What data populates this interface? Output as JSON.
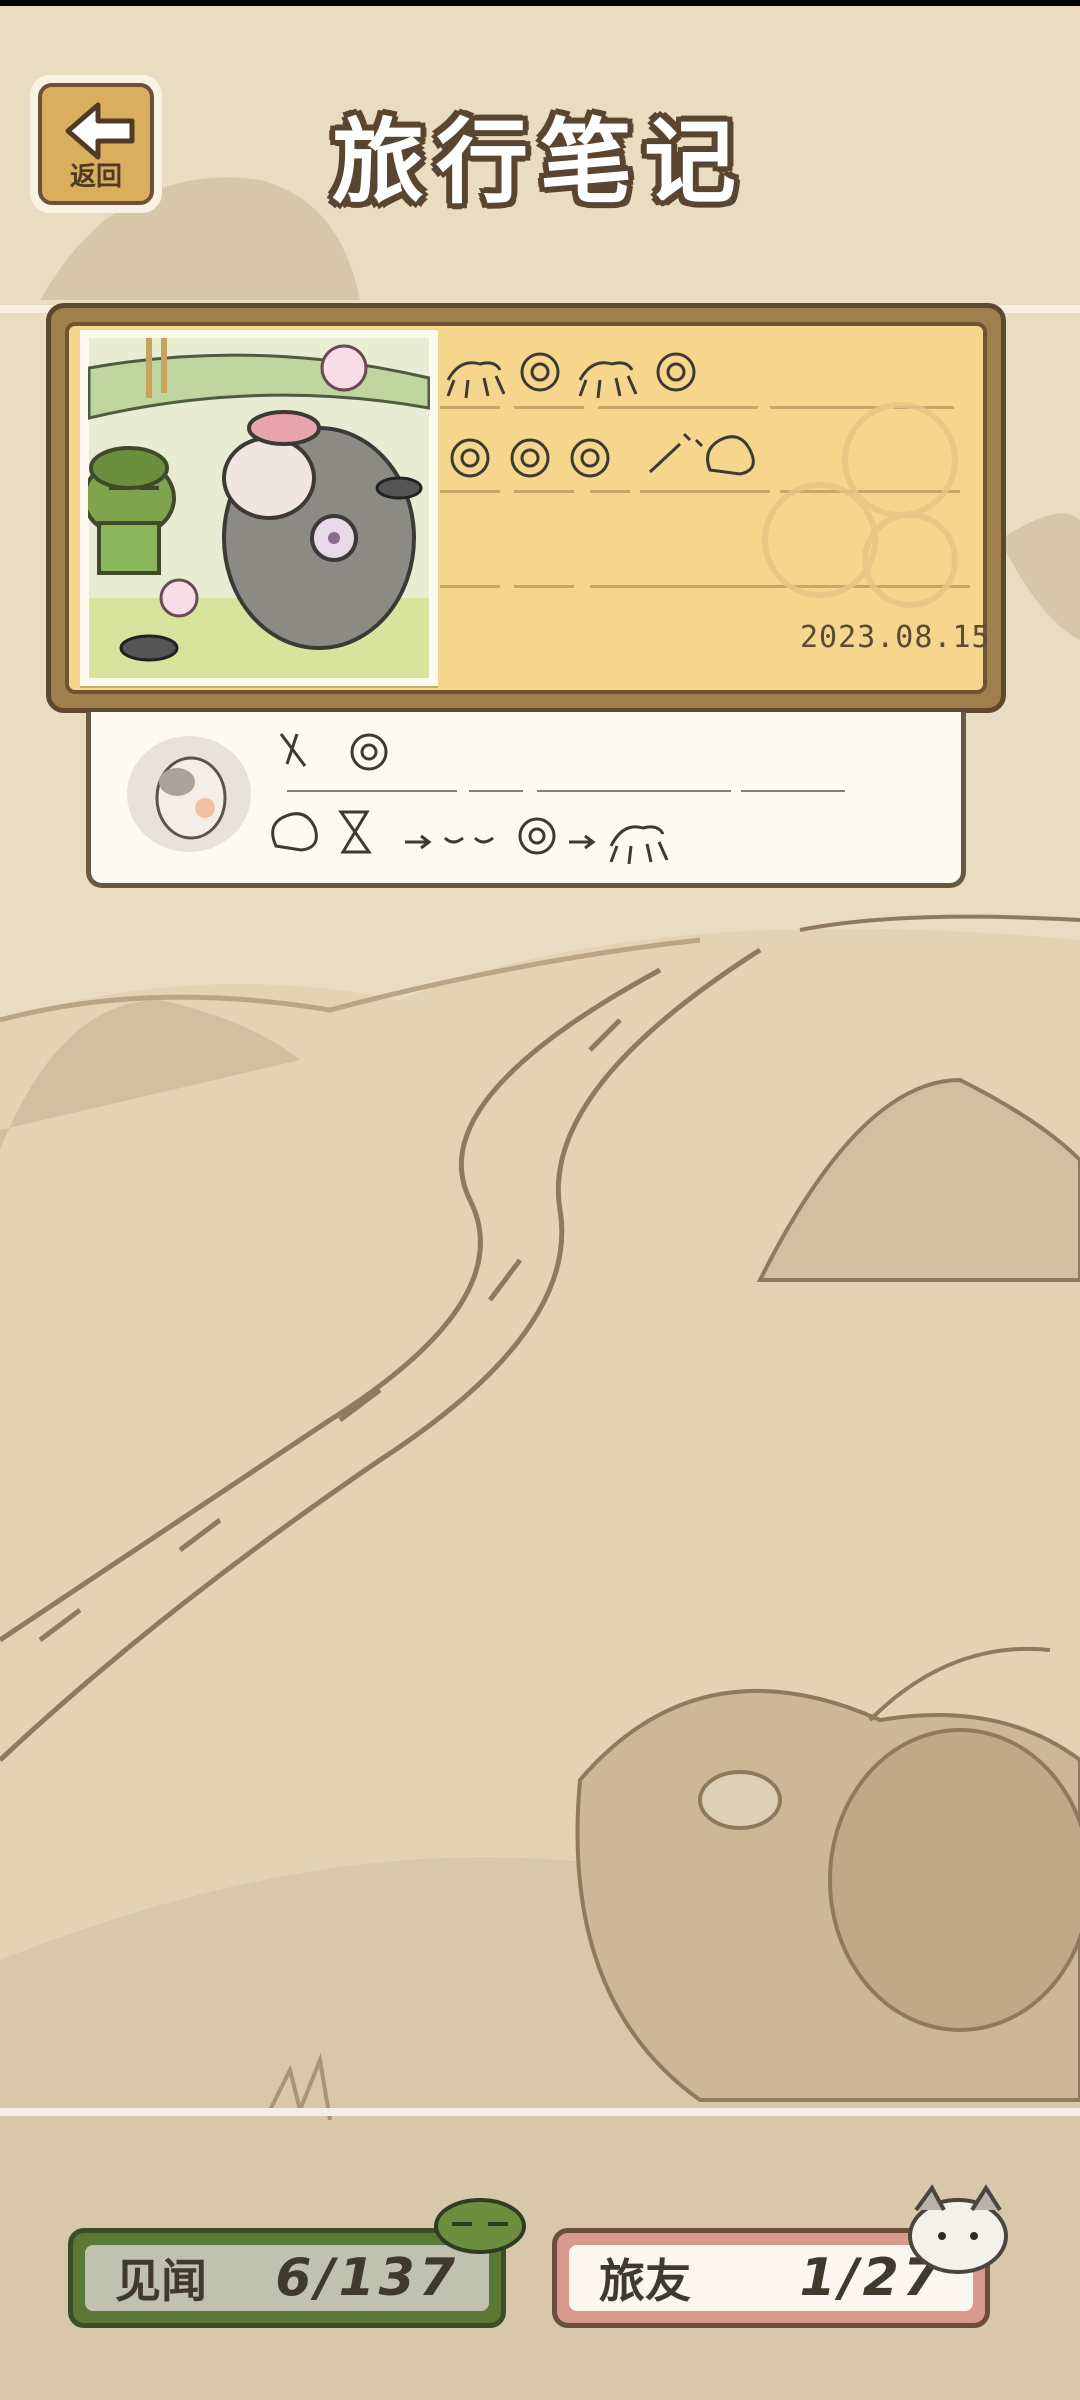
{
  "header": {
    "title": "旅行笔记",
    "back_label": "返回"
  },
  "journal_entry": {
    "date": "2023.08.15"
  },
  "stats": {
    "sights_label": "见闻",
    "sights_count": "6/137",
    "friends_label": "旅友",
    "friends_count": "1/27"
  },
  "colors": {
    "background": "#eadcc0",
    "card_yellow": "#f6d68d",
    "card_frame": "#9f7f4c",
    "sights_green": "#5b7837",
    "friends_pink": "#d99a8d"
  },
  "icons": {
    "back": "left-arrow-icon",
    "frog": "frog-icon",
    "hamster": "hamster-icon",
    "ant": "ant-icon",
    "flower": "flower-icon"
  }
}
